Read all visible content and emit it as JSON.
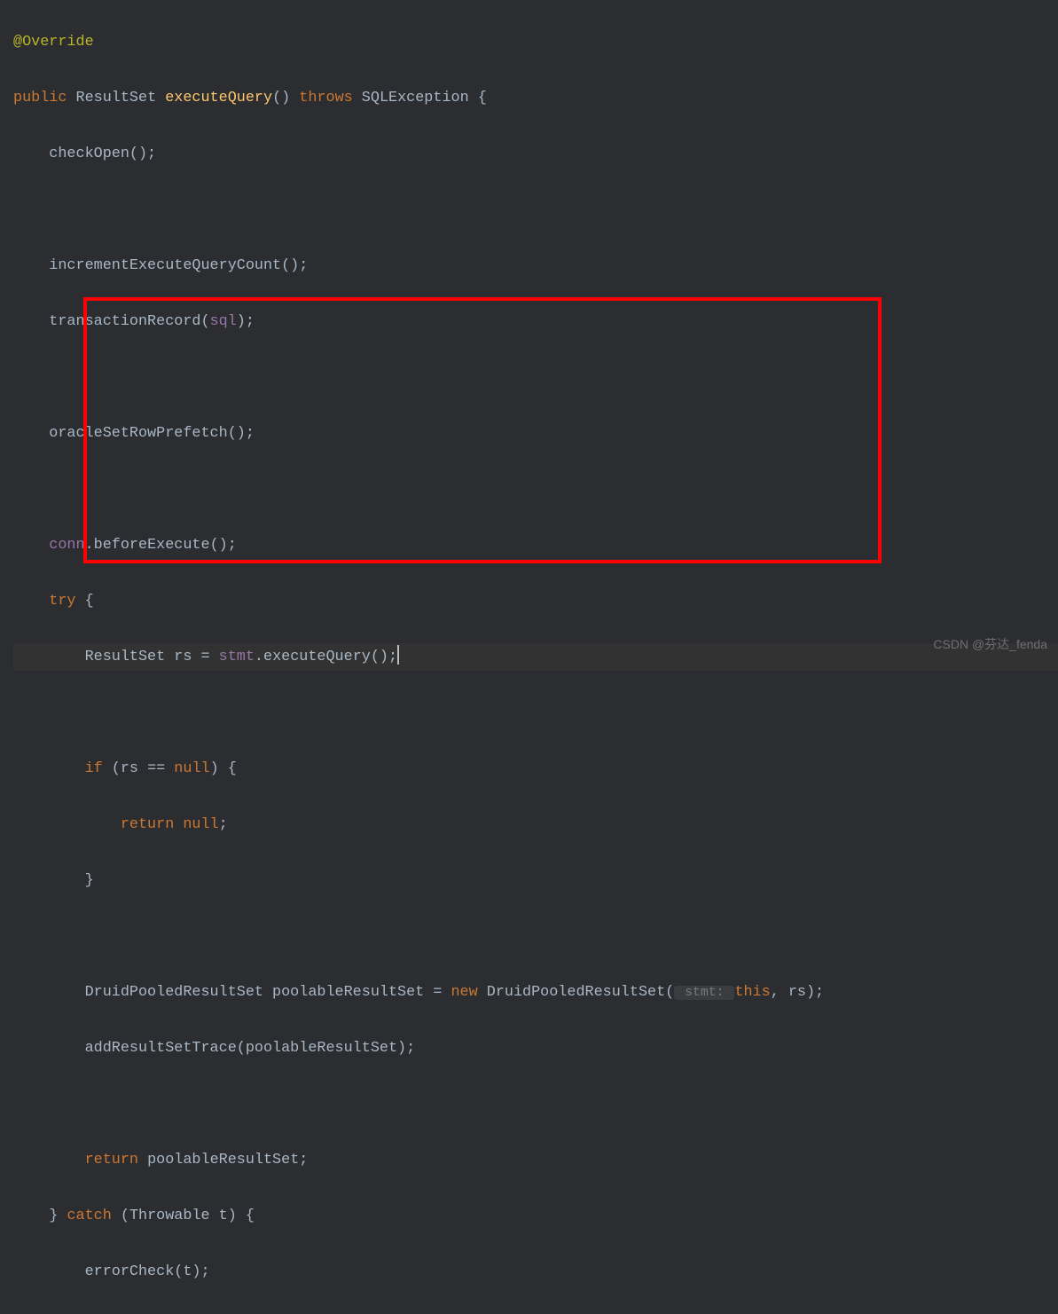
{
  "code": {
    "line1_annotation": "@Override",
    "line2_public": "public",
    "line2_type": " ResultSet ",
    "line2_method": "executeQuery",
    "line2_parens": "() ",
    "line2_throws": "throws",
    "line2_exception": " SQLException {",
    "line3": "    checkOpen();",
    "line5": "    incrementExecuteQueryCount();",
    "line6_a": "    transactionRecord(",
    "line6_field": "sql",
    "line6_b": ");",
    "line8": "    oracleSetRowPrefetch();",
    "line10_field": "    conn",
    "line10_b": ".beforeExecute();",
    "line11_try": "    try",
    "line11_brace": " {",
    "line12_a": "        ResultSet rs = ",
    "line12_field": "stmt",
    "line12_b": ".executeQuery();",
    "line14_if": "        if",
    "line14_a": " (rs == ",
    "line14_null": "null",
    "line14_b": ") {",
    "line15_return": "            return null",
    "line15_semi": ";",
    "line16": "        }",
    "line18_a": "        DruidPooledResultSet poolableResultSet = ",
    "line18_new": "new",
    "line18_b": " DruidPooledResultSet(",
    "line18_hint": " stmt: ",
    "line18_this": "this",
    "line18_c": ", rs);",
    "line19": "        addResultSetTrace(poolableResultSet);",
    "line21_return": "        return",
    "line21_b": " poolableResultSet;",
    "line22_a": "    } ",
    "line22_catch": "catch",
    "line22_b": " (Throwable t) {",
    "line23": "        errorCheck(t);"
  },
  "watermark": "CSDN @芬达_fenda"
}
